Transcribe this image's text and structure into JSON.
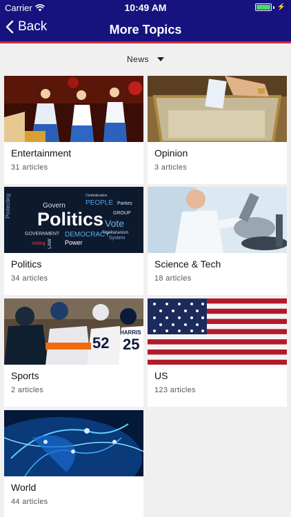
{
  "status_bar": {
    "carrier": "Carrier",
    "time": "10:49 AM"
  },
  "nav": {
    "back_label": "Back",
    "title": "More Topics"
  },
  "filter": {
    "selected": "News"
  },
  "topics": [
    {
      "title": "Entertainment",
      "count": "31 articles",
      "image_icon": "dancers-photo"
    },
    {
      "title": "Opinion",
      "count": "3 articles",
      "image_icon": "ballot-box-photo"
    },
    {
      "title": "Politics",
      "count": "34 articles",
      "image_icon": "politics-wordcloud",
      "image_text": {
        "main": "Politics",
        "words": [
          "Protecting",
          "Govern",
          "PEOPLE",
          "Vote",
          "GOVERNMENT",
          "DEMOCRACY",
          "Power",
          "LAW",
          "Voting",
          "GROUP",
          "Totalitarianism",
          "System",
          "Confederation",
          "Parties"
        ]
      }
    },
    {
      "title": "Science & Tech",
      "count": "18 articles",
      "image_icon": "microscope-photo"
    },
    {
      "title": "Sports",
      "count": "2 articles",
      "image_icon": "football-players-photo",
      "image_text": {
        "jerseys": [
          "52",
          "25"
        ],
        "name": "HARRIS"
      }
    },
    {
      "title": "US",
      "count": "123 articles",
      "image_icon": "american-flag-photo"
    },
    {
      "title": "World",
      "count": "44 articles",
      "image_icon": "globe-network-photo"
    }
  ],
  "colors": {
    "header": "#16137e",
    "header_accent": "#d2263a",
    "background": "#f0f0f0",
    "battery": "#4cd964"
  }
}
